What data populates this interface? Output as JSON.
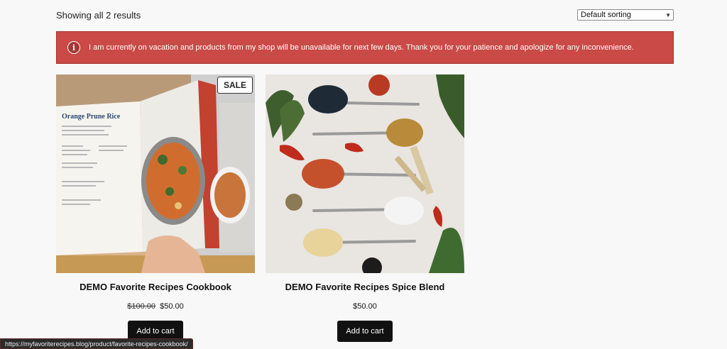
{
  "toolbar": {
    "result_count": "Showing all 2 results",
    "sort_selected": "Default sorting"
  },
  "notice": {
    "icon": "info-icon",
    "text": "I am currently on vacation and products from my shop will be unavailable for next few days. Thank you for your patience and apologize for any inconvenience.",
    "color": "#c94a46"
  },
  "products": [
    {
      "badge": "SALE",
      "title": "DEMO Favorite Recipes Cookbook",
      "old_price": "$100.00",
      "price": "$50.00",
      "button": "Add to cart",
      "image_caption": "Orange Prune Rice"
    },
    {
      "title": "DEMO Favorite Recipes Spice Blend",
      "price": "$50.00",
      "button": "Add to cart"
    }
  ],
  "status_bar": {
    "url": "https://myfavoriterecipes.blog/product/favorite-recipes-cookbook/"
  }
}
